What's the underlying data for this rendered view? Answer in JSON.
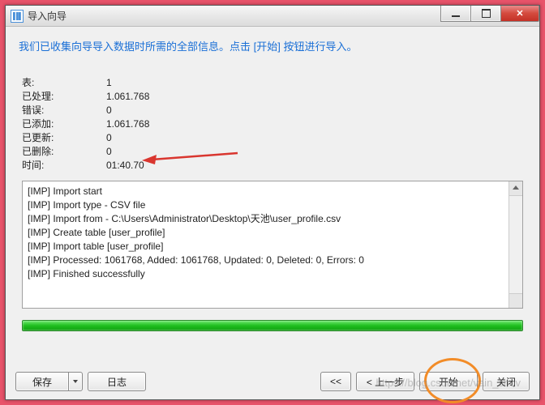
{
  "window": {
    "title": "导入向导"
  },
  "instruction": "我们已收集向导导入数据时所需的全部信息。点击 [开始] 按钮进行导入。",
  "stats": [
    {
      "label": "表:",
      "value": "1"
    },
    {
      "label": "已处理:",
      "value": "1.061.768"
    },
    {
      "label": "错误:",
      "value": "0"
    },
    {
      "label": "已添加:",
      "value": "1.061.768"
    },
    {
      "label": "已更新:",
      "value": "0"
    },
    {
      "label": "已删除:",
      "value": "0"
    },
    {
      "label": "时间:",
      "value": "01:40.70"
    }
  ],
  "log": [
    "[IMP] Import start",
    "[IMP] Import type - CSV file",
    "[IMP] Import from - C:\\Users\\Administrator\\Desktop\\天池\\user_profile.csv",
    "[IMP] Create table [user_profile]",
    "[IMP] Import table [user_profile]",
    "[IMP] Processed: 1061768, Added: 1061768, Updated: 0, Deleted: 0, Errors: 0",
    "[IMP] Finished successfully"
  ],
  "buttons": {
    "save": "保存",
    "log": "日志",
    "first": "<<",
    "prev": "< 上一步",
    "start": "开始",
    "close": "关闭"
  },
  "watermark": "https://blog.csdn.net/vain_shov"
}
